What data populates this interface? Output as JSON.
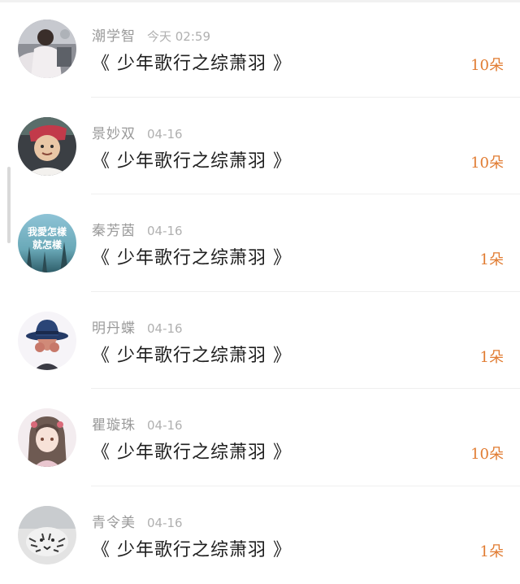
{
  "rows": [
    {
      "name": "潮学智",
      "time": "今天 02:59",
      "title": "《 少年歌行之综萧羽 》",
      "count": "10朵",
      "avatar": "photo-girl-icon"
    },
    {
      "name": "景妙双",
      "time": "04-16",
      "title": "《 少年歌行之综萧羽 》",
      "count": "10朵",
      "avatar": "photo-child-icon"
    },
    {
      "name": "秦芳茵",
      "time": "04-16",
      "title": "《 少年歌行之综萧羽 》",
      "count": "1朵",
      "avatar": "text-avatar-icon",
      "avatar_text": [
        "我愛怎樣",
        "就怎樣"
      ]
    },
    {
      "name": "明丹蝶",
      "time": "04-16",
      "title": "《 少年歌行之综萧羽 》",
      "count": "1朵",
      "avatar": "hat-figure-icon"
    },
    {
      "name": "瞿璇珠",
      "time": "04-16",
      "title": "《 少年歌行之综萧羽 》",
      "count": "10朵",
      "avatar": "anime-girl-icon"
    },
    {
      "name": "青令美",
      "time": "04-16",
      "title": "《 少年歌行之综萧羽 》",
      "count": "1朵",
      "avatar": "tiger-icon"
    }
  ],
  "colors": {
    "accent": "#e17c32",
    "name": "#9a9a9a",
    "title": "#1f1f1f"
  }
}
